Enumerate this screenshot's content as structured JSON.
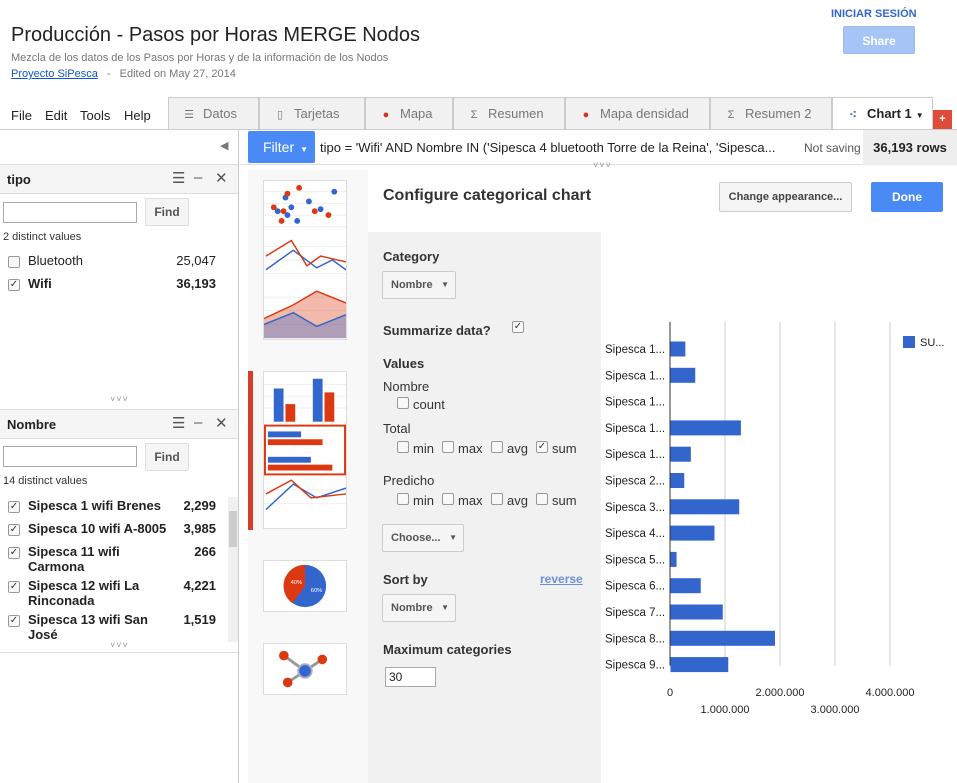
{
  "header": {
    "title": "Producción - Pasos por Horas MERGE Nodos",
    "description": "Mezcla de los datos de los Pasos por Horas y de la información de los Nodos",
    "project_link": "Proyecto SiPesca",
    "separator": "-",
    "edited": "Edited on May 27, 2014",
    "signin": "INICIAR SESIÓN",
    "share": "Share"
  },
  "menu": [
    "File",
    "Edit",
    "Tools",
    "Help"
  ],
  "tabs": [
    {
      "label": "Datos",
      "icon": "grid-icon"
    },
    {
      "label": "Tarjetas",
      "icon": "cards-icon"
    },
    {
      "label": "Mapa",
      "icon": "map-pin-icon"
    },
    {
      "label": "Resumen",
      "icon": "summary-icon"
    },
    {
      "label": "Mapa densidad",
      "icon": "map-pin-icon"
    },
    {
      "label": "Resumen 2",
      "icon": "summary-icon"
    },
    {
      "label": "Chart 1",
      "icon": "scatter-chart-icon",
      "active": true
    }
  ],
  "add_tab": "+",
  "filter_bar": {
    "button": "Filter",
    "expression": "tipo = 'Wifi' AND Nombre IN ('Sipesca 4 bluetooth Torre de la Reina', 'Sipesca...",
    "status": "Not saving",
    "rows": "36,193 rows"
  },
  "filters": [
    {
      "title": "tipo",
      "find": "Find",
      "distinct": "2 distinct values",
      "items": [
        {
          "label": "Bluetooth",
          "value": "25,047",
          "checked": false
        },
        {
          "label": "Wifi",
          "value": "36,193",
          "checked": true
        }
      ]
    },
    {
      "title": "Nombre",
      "find": "Find",
      "distinct": "14 distinct values",
      "items": [
        {
          "label": "Sipesca 1 wifi Brenes",
          "value": "2,299",
          "checked": true
        },
        {
          "label": "Sipesca 10 wifi A-8005",
          "value": "3,985",
          "checked": true
        },
        {
          "label": "Sipesca 11 wifi Carmona",
          "value": "266",
          "checked": true
        },
        {
          "label": "Sipesca 12 wifi La Rinconada",
          "value": "4,221",
          "checked": true
        },
        {
          "label": "Sipesca 13 wifi San José",
          "value": "1,519",
          "checked": true
        }
      ]
    }
  ],
  "config": {
    "title": "Configure categorical chart",
    "appearance_button": "Change appearance...",
    "done_button": "Done",
    "category_label": "Category",
    "category_value": "Nombre",
    "summarize_label": "Summarize data?",
    "values_label": "Values",
    "nombre_label": "Nombre",
    "count_label": "count",
    "total_label": "Total",
    "predicho_label": "Predicho",
    "agg": [
      "min",
      "max",
      "avg",
      "sum"
    ],
    "choose": "Choose...",
    "sort_label": "Sort by",
    "reverse": "reverse",
    "sort_value": "Nombre",
    "max_label": "Maximum categories",
    "max_value": "30"
  },
  "colors": {
    "primary": "#3366cc",
    "accent": "#dc3912",
    "button_blue": "#4a8af4"
  },
  "chart_data": {
    "type": "bar",
    "orientation": "horizontal",
    "categories": [
      "Sipesca 1...",
      "Sipesca 1...",
      "Sipesca 1...",
      "Sipesca 1...",
      "Sipesca 1...",
      "Sipesca 2...",
      "Sipesca 3...",
      "Sipesca 4...",
      "Sipesca 5...",
      "Sipesca 6...",
      "Sipesca 7...",
      "Sipesca 8...",
      "Sipesca 9..."
    ],
    "series": [
      {
        "name": "SU...",
        "color": "#3366cc",
        "values": [
          270000,
          450000,
          0,
          1280000,
          370000,
          250000,
          1250000,
          800000,
          110000,
          550000,
          950000,
          1900000,
          1050000
        ]
      }
    ],
    "xlim": [
      0,
      4000000
    ],
    "xticks": [
      0,
      1000000,
      2000000,
      3000000,
      4000000
    ],
    "xtick_labels": [
      "0",
      "1.000.000",
      "2.000.000",
      "3.000.000",
      "4.000.000"
    ],
    "grid": true,
    "legend": "top-right"
  }
}
